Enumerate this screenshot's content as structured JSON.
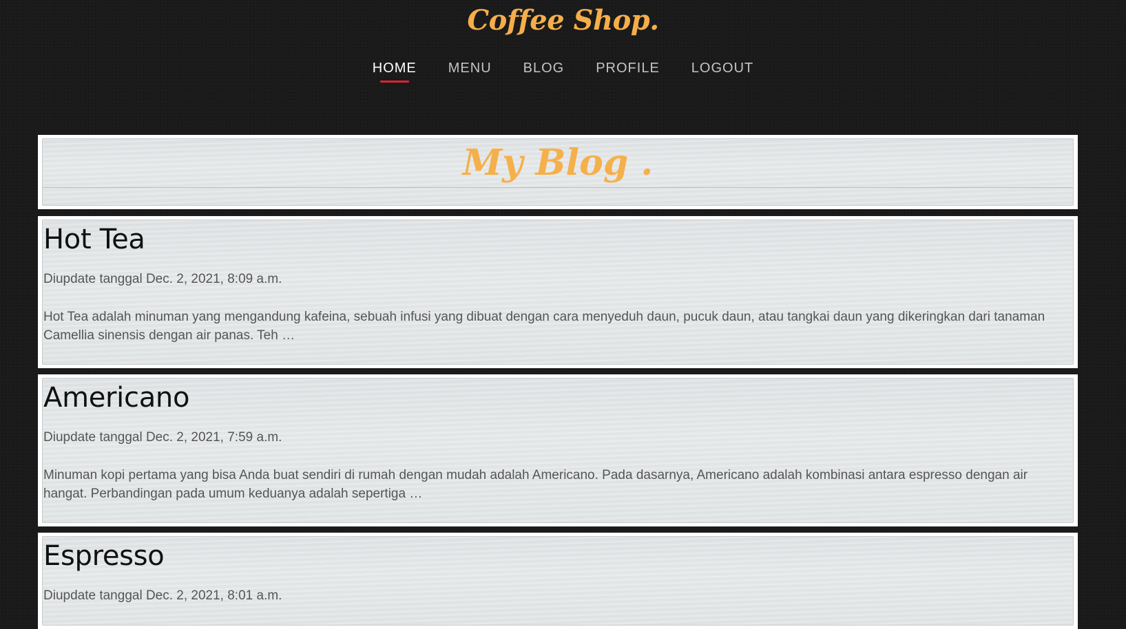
{
  "header": {
    "brand": "Coffee Shop.",
    "nav": [
      {
        "label": "HOME",
        "active": true
      },
      {
        "label": "MENU",
        "active": false
      },
      {
        "label": "BLOG",
        "active": false
      },
      {
        "label": "PROFILE",
        "active": false
      },
      {
        "label": "LOGOUT",
        "active": false
      }
    ]
  },
  "main": {
    "title": "My Blog .",
    "posts": [
      {
        "title": "Hot Tea",
        "date": "Diupdate tanggal Dec. 2, 2021, 8:09 a.m.",
        "excerpt": "Hot Tea adalah minuman yang mengandung kafeina, sebuah infusi yang dibuat dengan cara menyeduh daun, pucuk daun, atau tangkai daun yang dikeringkan dari tanaman Camellia sinensis dengan air panas. Teh …"
      },
      {
        "title": "Americano",
        "date": "Diupdate tanggal Dec. 2, 2021, 7:59 a.m.",
        "excerpt": "Minuman kopi pertama yang bisa Anda buat sendiri di rumah dengan mudah adalah Americano. Pada dasarnya, Americano adalah kombinasi antara espresso dengan air hangat. Perbandingan pada umum keduanya adalah sepertiga …"
      },
      {
        "title": "Espresso",
        "date": "Diupdate tanggal Dec. 2, 2021, 8:01 a.m."
      }
    ]
  },
  "colors": {
    "background": "#1a1a1a",
    "accent": "#f5ae4a",
    "active_underline": "#e02233",
    "panel": "#e2e5e6"
  }
}
